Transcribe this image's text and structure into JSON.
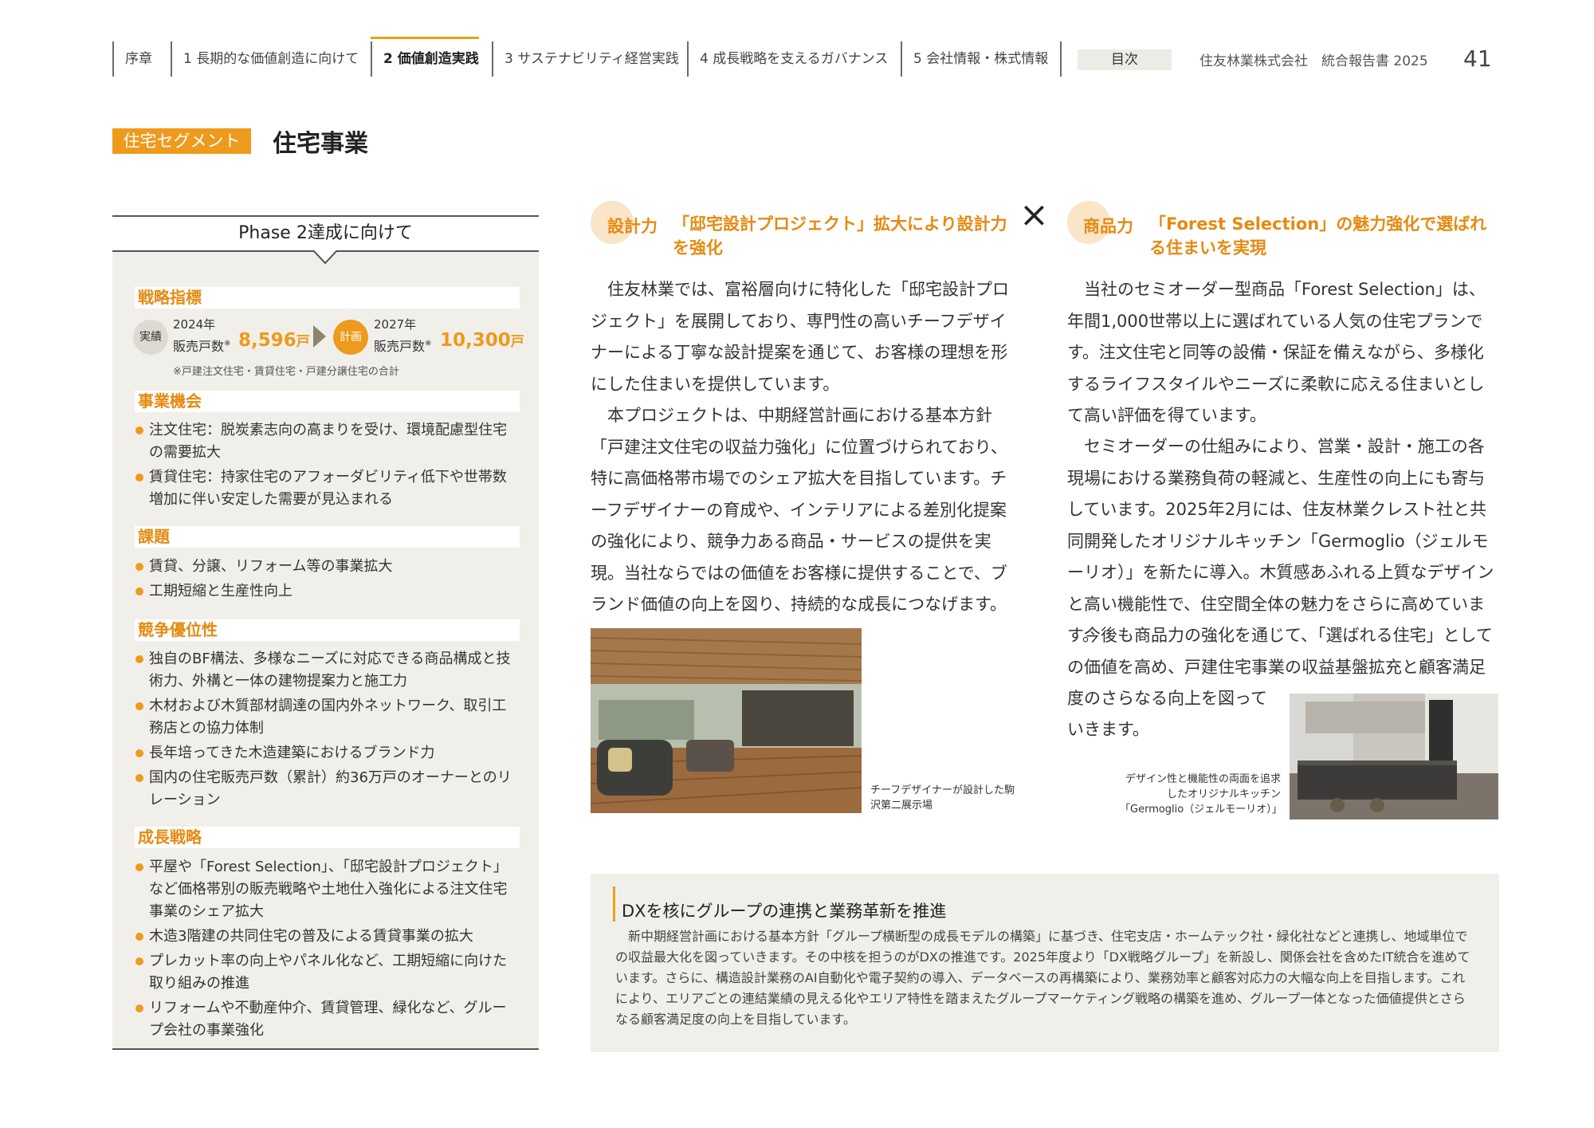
{
  "nav": {
    "items": [
      "序章",
      "1 長期的な価値創造に向けて",
      "2 価値創造実践",
      "3 サステナビリティ経営実践",
      "4 成長戦略を支えるガバナンス",
      "5 会社情報・株式情報"
    ],
    "toc": "目次",
    "company": "住友林業株式会社　統合報告書 2025",
    "page_number": "41",
    "accent_color": "#e8a21a"
  },
  "segment": {
    "badge": "住宅セグメント",
    "title": "住宅事業"
  },
  "left": {
    "phase_title": "Phase 2達成に向けて",
    "kpi": {
      "heading": "戦略指標",
      "actual_badge": "実績",
      "actual_year": "2024年",
      "actual_label": "販売戸数",
      "actual_value": "8,596",
      "plan_badge": "計画",
      "plan_year": "2027年",
      "plan_label": "販売戸数",
      "plan_value": "10,300",
      "unit": "戸",
      "mark": "※",
      "note": "※戸建注文住宅・賃貸住宅・戸建分譲住宅の合計"
    },
    "opportunities": {
      "heading": "事業機会",
      "items": [
        "注文住宅：脱炭素志向の高まりを受け、環境配慮型住宅の需要拡大",
        "賃貸住宅：持家住宅のアフォーダビリティ低下や世帯数増加に伴い安定した需要が見込まれる"
      ]
    },
    "issues": {
      "heading": "課題",
      "items": [
        "賃貸、分譲、リフォーム等の事業拡大",
        "工期短縮と生産性向上"
      ]
    },
    "advantages": {
      "heading": "競争優位性",
      "items": [
        "独自のBF構法、多様なニーズに対応できる商品構成と技術力、外構と一体の建物提案力と施工力",
        "木材および木質部材調達の国内外ネットワーク、取引工務店との協力体制",
        "長年培ってきた木造建築におけるブランド力",
        "国内の住宅販売戸数（累計）約36万戸のオーナーとのリレーション"
      ]
    },
    "growth": {
      "heading": "成長戦略",
      "items": [
        "平屋や「Forest Selection」、「邸宅設計プロジェクト」など価格帯別の販売戦略や土地仕入強化による注文住宅事業のシェア拡大",
        "木造3階建の共同住宅の普及による賃貸事業の拡大",
        "プレカット率の向上やパネル化など、工期短縮に向けた取り組みの推進",
        "リフォームや不動産仲介、賃貸管理、緑化など、グループ会社の事業強化"
      ]
    }
  },
  "design": {
    "tag": "設計力",
    "title": "「邸宅設計プロジェクト」拡大により設計力を強化",
    "para1": "住友林業では、富裕層向けに特化した「邸宅設計プロジェクト」を展開しており、専門性の高いチーフデザイナーによる丁寧な設計提案を通じて、お客様の理想を形にした住まいを提供しています。",
    "para2": "本プロジェクトは、中期経営計画における基本方針「戸建注文住宅の収益力強化」に位置づけられており、特に高価格帯市場でのシェア拡大を目指しています。チーフデザイナーの育成や、インテリアによる差別化提案の強化により、競争力ある商品・サービスの提供を実現。当社ならではの価値をお客様に提供することで、ブランド価値の向上を図り、持続的な成長につなげます。",
    "caption": "チーフデザイナーが設計した駒沢第二展示場"
  },
  "cross_symbol": "×",
  "product": {
    "tag": "商品力",
    "title": "「Forest Selection」の魅力強化で選ばれる住まいを実現",
    "para1": "当社のセミオーダー型商品「Forest Selection」は、年間1,000世帯以上に選ばれている人気の住宅プランです。注文住宅と同等の設備・保証を備えながら、多様化するライフスタイルやニーズに柔軟に応える住まいとして高い評価を得ています。",
    "para2": "セミオーダーの仕組みにより、営業・設計・施工の各現場における業務負荷の軽減と、生産性の向上にも寄与しています。2025年2月には、住友林業クレスト社と共同開発したオリジナルキッチン「Germoglio（ジェルモーリオ）」を新たに導入。木質感あふれる上質なデザインと高い機能性で、住空間全体の魅力をさらに高めています。",
    "para3_a": "今後も商品力の強化を通じて、「選ばれる住宅」としての価値を高め、戸建住宅事業の収益基盤拡充と顧客満足度のさらなる向上を図って",
    "para3_b": "いきます。",
    "caption": "デザイン性と機能性の両面を追求したオリジナルキッチン「Germoglio（ジェルモーリオ）」"
  },
  "dx": {
    "title": "DXを核にグループの連携と業務革新を推進",
    "body": "新中期経営計画における基本方針「グループ横断型の成長モデルの構築」に基づき、住宅支店・ホームテック社・緑化社などと連携し、地域単位での収益最大化を図っていきます。その中核を担うのがDXの推進です。2025年度より「DX戦略グループ」を新設し、関係会社を含めたIT統合を進めています。さらに、構造設計業務のAI自動化や電子契約の導入、データベースの再構築により、業務効率と顧客対応力の大幅な向上を目指します。これにより、エリアごとの連結業績の見える化やエリア特性を踏まえたグループマーケティング戦略の構築を進め、グループ一体となった価値提供とさらなる顧客満足度の向上を目指しています。"
  }
}
